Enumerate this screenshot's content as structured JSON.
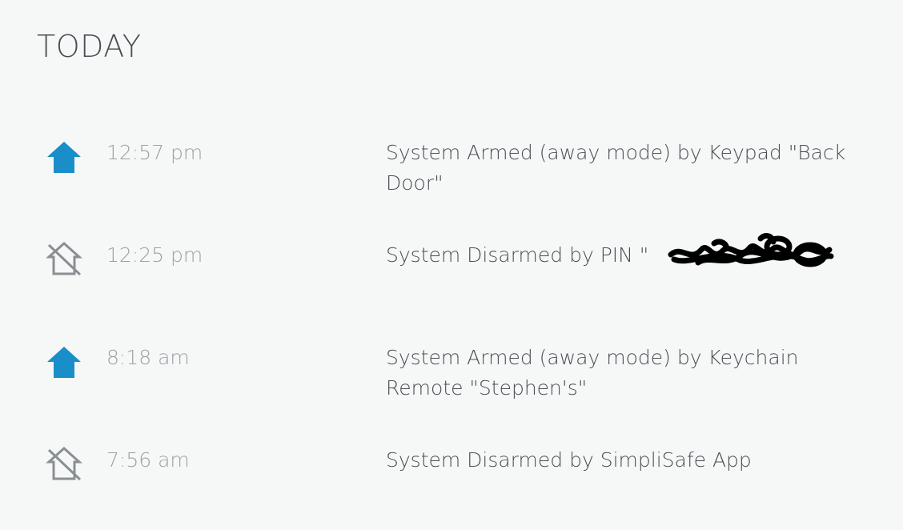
{
  "section": {
    "title": "TODAY"
  },
  "events": [
    {
      "icon": "armed-home-icon",
      "icon_color": "#1a8ec8",
      "time": "12:57 pm",
      "description": "System Armed (away mode) by Keypad \"Back Door\""
    },
    {
      "icon": "disarmed-home-icon",
      "icon_color": "#8a8f93",
      "time": "12:25 pm",
      "description": "System Disarmed by PIN \"                \""
    },
    {
      "icon": "armed-home-icon",
      "icon_color": "#1a8ec8",
      "time": "8:18 am",
      "description": "System Armed (away mode) by Keychain Remote \"Stephen's\""
    },
    {
      "icon": "disarmed-home-icon",
      "icon_color": "#8a8f93",
      "time": "7:56 am",
      "description": "System Disarmed by SimpliSafe App"
    }
  ]
}
